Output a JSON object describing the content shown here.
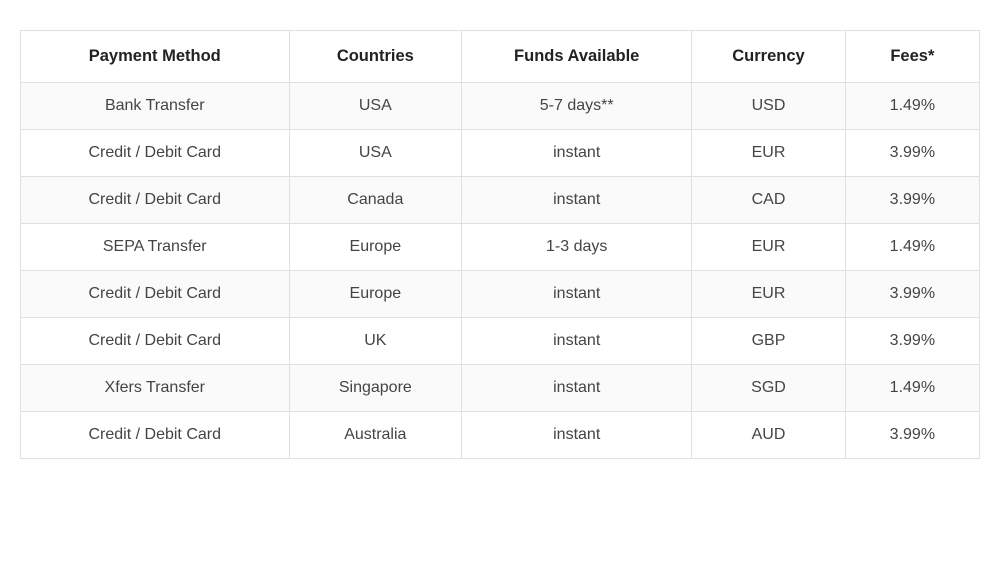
{
  "table": {
    "headers": {
      "method": "Payment Method",
      "countries": "Countries",
      "funds": "Funds Available",
      "currency": "Currency",
      "fees": "Fees*"
    },
    "rows": [
      {
        "method": "Bank Transfer",
        "countries": "USA",
        "funds": "5-7 days**",
        "currency": "USD",
        "fees": "1.49%"
      },
      {
        "method": "Credit / Debit Card",
        "countries": "USA",
        "funds": "instant",
        "currency": "EUR",
        "fees": "3.99%"
      },
      {
        "method": "Credit / Debit Card",
        "countries": "Canada",
        "funds": "instant",
        "currency": "CAD",
        "fees": "3.99%"
      },
      {
        "method": "SEPA Transfer",
        "countries": "Europe",
        "funds": "1-3 days",
        "currency": "EUR",
        "fees": "1.49%"
      },
      {
        "method": "Credit / Debit Card",
        "countries": "Europe",
        "funds": "instant",
        "currency": "EUR",
        "fees": "3.99%"
      },
      {
        "method": "Credit / Debit Card",
        "countries": "UK",
        "funds": "instant",
        "currency": "GBP",
        "fees": "3.99%"
      },
      {
        "method": "Xfers Transfer",
        "countries": "Singapore",
        "funds": "instant",
        "currency": "SGD",
        "fees": "1.49%"
      },
      {
        "method": "Credit / Debit Card",
        "countries": "Australia",
        "funds": "instant",
        "currency": "AUD",
        "fees": "3.99%"
      }
    ]
  }
}
